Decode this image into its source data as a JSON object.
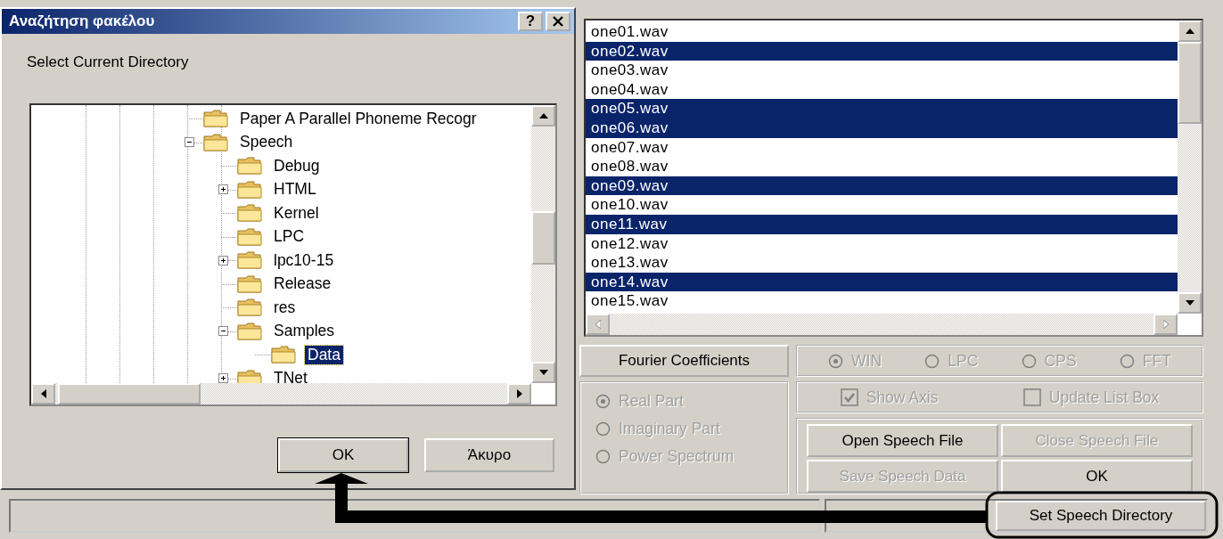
{
  "dialog": {
    "title": "Αναζήτηση φακέλου",
    "help_button": "?",
    "prompt": "Select Current Directory",
    "tree": [
      {
        "label": "Paper A Parallel Phoneme Recogr",
        "selected": false
      },
      {
        "label": "Speech",
        "expanded": true,
        "selected": false,
        "children": [
          {
            "label": "Debug",
            "selected": false
          },
          {
            "label": "HTML",
            "expanded": false,
            "selected": false
          },
          {
            "label": "Kernel",
            "selected": false
          },
          {
            "label": "LPC",
            "selected": false
          },
          {
            "label": "lpc10-15",
            "expanded": false,
            "selected": false
          },
          {
            "label": "Release",
            "selected": false
          },
          {
            "label": "res",
            "selected": false
          },
          {
            "label": "Samples",
            "expanded": true,
            "selected": false,
            "children": [
              {
                "label": "Data",
                "selected": true
              }
            ]
          },
          {
            "label": "TNet",
            "expanded": false,
            "selected": false
          }
        ]
      }
    ],
    "buttons": [
      {
        "label": "OK",
        "default": true
      },
      {
        "label": "Άκυρο",
        "default": false
      }
    ]
  },
  "files": [
    {
      "label": "one01.wav",
      "selected": false
    },
    {
      "label": "one02.wav",
      "selected": true
    },
    {
      "label": "one03.wav",
      "selected": false
    },
    {
      "label": "one04.wav",
      "selected": false
    },
    {
      "label": "one05.wav",
      "selected": true
    },
    {
      "label": "one06.wav",
      "selected": true
    },
    {
      "label": "one07.wav",
      "selected": false
    },
    {
      "label": "one08.wav",
      "selected": false
    },
    {
      "label": "one09.wav",
      "selected": true
    },
    {
      "label": "one10.wav",
      "selected": false
    },
    {
      "label": "one11.wav",
      "selected": true
    },
    {
      "label": "one12.wav",
      "selected": false
    },
    {
      "label": "one13.wav",
      "selected": false
    },
    {
      "label": "one14.wav",
      "selected": true
    },
    {
      "label": "one15.wav",
      "selected": false
    }
  ],
  "fourier_button": "Fourier Coefficients",
  "method_radios": [
    {
      "label": "WIN",
      "selected": true,
      "disabled": true
    },
    {
      "label": "LPC",
      "selected": false,
      "disabled": true
    },
    {
      "label": "CPS",
      "selected": false,
      "disabled": true
    },
    {
      "label": "FFT",
      "selected": false,
      "disabled": true
    }
  ],
  "part_radios": [
    {
      "label": "Real Part",
      "selected": true,
      "disabled": true
    },
    {
      "label": "Imaginary Part",
      "selected": false,
      "disabled": true
    },
    {
      "label": "Power Spectrum",
      "selected": false,
      "disabled": true
    }
  ],
  "checkboxes": [
    {
      "label": "Show Axis",
      "checked": true,
      "disabled": true
    },
    {
      "label": "Update List Box",
      "checked": false,
      "disabled": true
    }
  ],
  "action_buttons": [
    {
      "label": "Open Speech File",
      "disabled": false
    },
    {
      "label": "Close Speech File",
      "disabled": true
    },
    {
      "label": "Save Speech Data",
      "disabled": true
    },
    {
      "label": "OK",
      "disabled": false
    }
  ],
  "set_directory_button": "Set Speech Directory"
}
